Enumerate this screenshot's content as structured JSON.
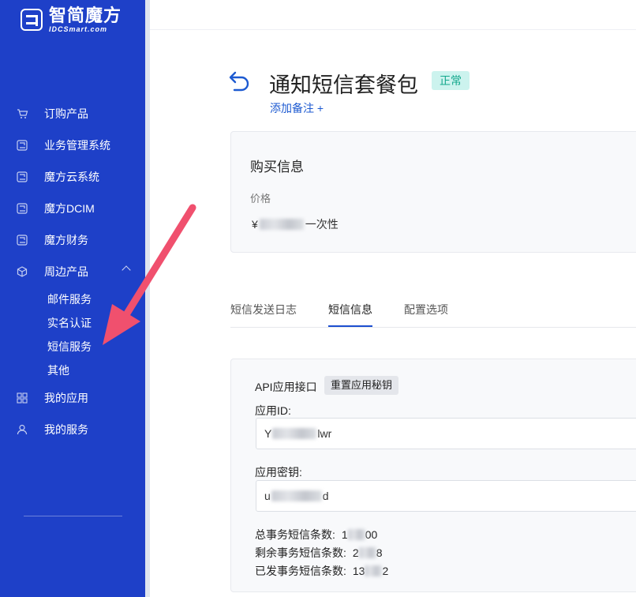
{
  "brand": {
    "name_cn": "智简魔方",
    "name_en": "IDCSmart.com"
  },
  "sidebar": {
    "items": [
      {
        "label": "订购产品",
        "icon": "cart-icon"
      },
      {
        "label": "业务管理系统",
        "icon": "product-logo-icon"
      },
      {
        "label": "魔方云系统",
        "icon": "product-logo-icon"
      },
      {
        "label": "魔方DCIM",
        "icon": "product-logo-icon"
      },
      {
        "label": "魔方财务",
        "icon": "product-logo-icon"
      },
      {
        "label": "周边产品",
        "icon": "cube-icon",
        "expanded": true
      }
    ],
    "subitems": [
      "邮件服务",
      "实名认证",
      "短信服务",
      "其他"
    ],
    "bottom_items": [
      {
        "label": "我的应用",
        "icon": "apps-grid-icon"
      },
      {
        "label": "我的服务",
        "icon": "user-icon"
      }
    ]
  },
  "page": {
    "title": "通知短信套餐包",
    "status": "正常",
    "add_note": "添加备注 +"
  },
  "purchase": {
    "title": "购买信息",
    "price_label": "价格",
    "price_prefix": "¥",
    "price_suffix": "一次性"
  },
  "tabs": [
    "短信发送日志",
    "短信信息",
    "配置选项"
  ],
  "active_tab": "短信信息",
  "api": {
    "label": "API应用接口",
    "reset_button": "重置应用秘钥",
    "app_id_label": "应用ID:",
    "app_id_start": "Y",
    "app_id_end": "lwr",
    "app_secret_label": "应用密钥:",
    "app_secret_start": "u",
    "app_secret_end": "d"
  },
  "stats": {
    "total_label": "总事务短信条数:",
    "total_start": "1",
    "total_end": "00",
    "remaining_label": "剩余事务短信条数:",
    "remaining_start": "2",
    "remaining_end": "8",
    "sent_label": "已发事务短信条数:",
    "sent_start": "13",
    "sent_end": "2"
  },
  "colors": {
    "sidebar": "#1e40c8",
    "accent": "#1d5ad1",
    "badge_bg": "#ccf3ee",
    "badge_text": "#14a88d",
    "annotation_arrow": "#f0506e"
  }
}
